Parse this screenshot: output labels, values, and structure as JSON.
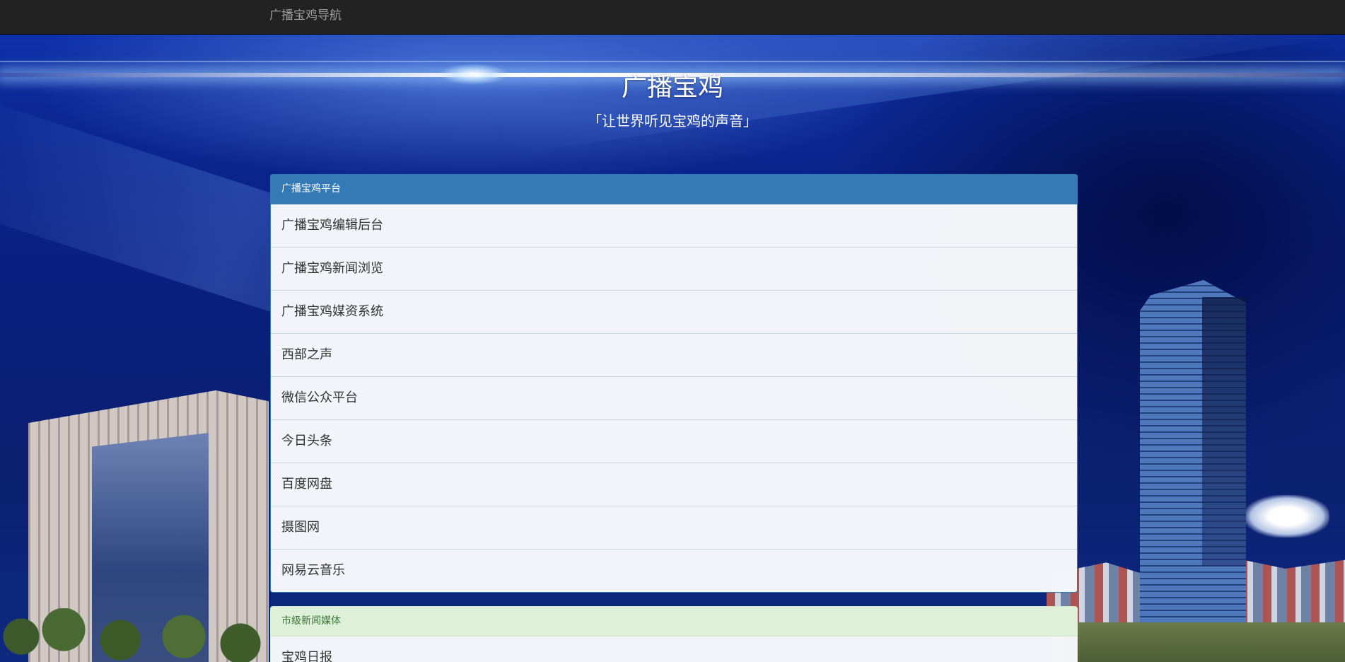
{
  "navbar": {
    "brand": "广播宝鸡导航"
  },
  "hero": {
    "title": "广播宝鸡",
    "subtitle": "「让世界听见宝鸡的声音」"
  },
  "panels": [
    {
      "heading": "广播宝鸡平台",
      "items": [
        "广播宝鸡编辑后台",
        "广播宝鸡新闻浏览",
        "广播宝鸡媒资系统",
        "西部之声",
        "微信公众平台",
        "今日头条",
        "百度网盘",
        "摄图网",
        "网易云音乐"
      ]
    },
    {
      "heading": "市级新闻媒体",
      "items": [
        "宝鸡日报"
      ]
    }
  ],
  "colors": {
    "navbar_bg": "#222222",
    "brand_text": "#9d9d9d",
    "panel_primary": "#337ab7",
    "panel_success_bg": "#dff0d8",
    "panel_success_text": "#3c763d"
  }
}
